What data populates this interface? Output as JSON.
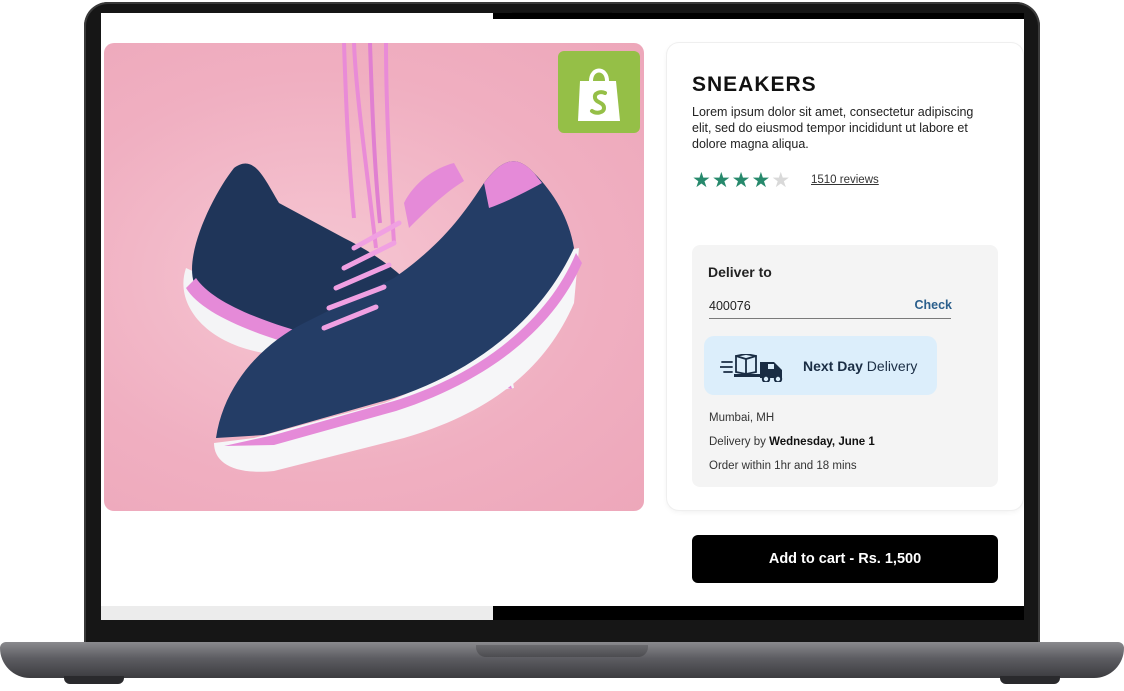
{
  "product": {
    "title": "SNEAKERS",
    "description": "Lorem ipsum dolor sit amet, consectetur adipiscing elit, sed do eiusmod tempor incididunt ut labore et dolore magna aliqua.",
    "rating": 4,
    "rating_max": 5,
    "reviews_label": "1510 reviews",
    "image_icon": "sneakers-image",
    "badge_icon": "shopify-bag-icon"
  },
  "delivery": {
    "heading": "Deliver to",
    "pincode": "400076",
    "check_label": "Check",
    "badge_bold": "Next Day",
    "badge_rest": " Delivery",
    "city": "Mumbai, MH",
    "delivery_by_prefix": "Delivery by ",
    "delivery_date": "Wednesday, June 1",
    "order_within": "Order within 1hr and 18 mins"
  },
  "cart": {
    "button_label": "Add to cart - Rs. 1,500"
  },
  "colors": {
    "star": "#27896c",
    "shopify_green": "#95bf47",
    "badge_bg": "#dceefb",
    "check_link": "#2b5f8c"
  }
}
